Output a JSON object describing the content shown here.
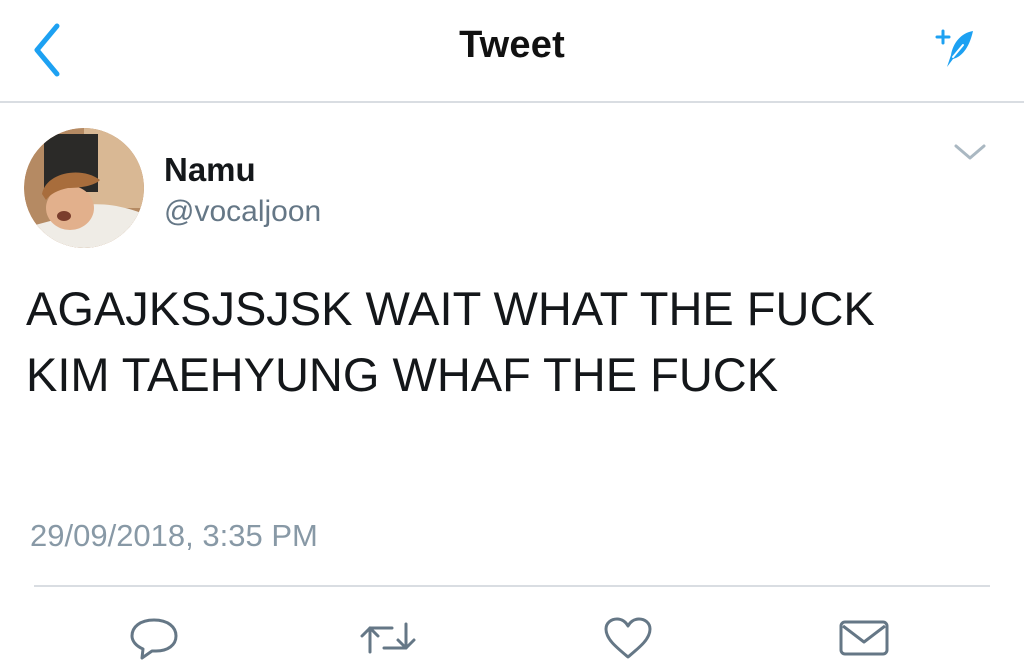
{
  "header": {
    "title": "Tweet",
    "back_icon": "chevron-left-icon",
    "compose_icon": "feather-sparkle-icon",
    "accent_color": "#1da1f2"
  },
  "tweet": {
    "author": {
      "display_name": "Namu",
      "handle": "@vocaljoon"
    },
    "text": "AGAJKSJSJSK WAIT WHAT THE FUCK\nKIM TAEHYUNG WHAF THE FUCK",
    "timestamp": "29/09/2018, 3:35 PM"
  },
  "actions": [
    {
      "name": "reply",
      "icon": "speech-bubble-icon"
    },
    {
      "name": "retweet",
      "icon": "retweet-icon"
    },
    {
      "name": "like",
      "icon": "heart-icon"
    },
    {
      "name": "direct-message",
      "icon": "envelope-icon"
    }
  ],
  "colors": {
    "text": "#14171a",
    "secondary": "#657786",
    "timestamp": "#8899a6",
    "divider": "#d9dde2",
    "icon": "#657786"
  }
}
